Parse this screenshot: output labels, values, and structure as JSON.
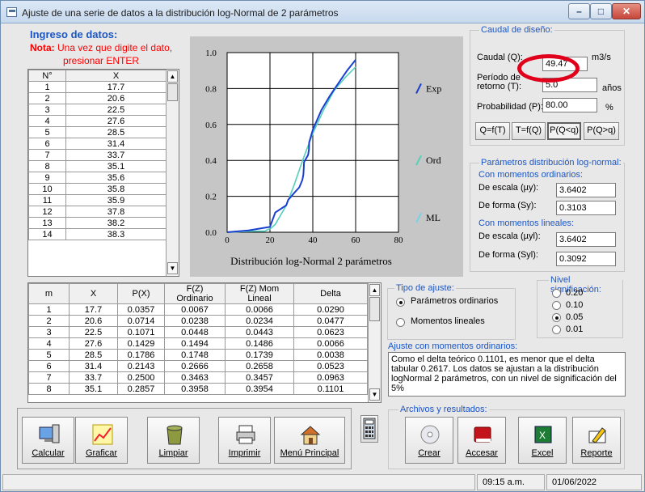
{
  "window": {
    "title": "Ajuste de una serie de datos a la distribución log-Normal de 2 parámetros"
  },
  "ingreso": {
    "title": "Ingreso de datos:",
    "note_bold": "Nota:",
    "note_text": "Una vez que digite el dato,",
    "note_text2": "presionar ENTER"
  },
  "table1": {
    "headers": [
      "N°",
      "X"
    ],
    "rows": [
      [
        "1",
        "17.7"
      ],
      [
        "2",
        "20.6"
      ],
      [
        "3",
        "22.5"
      ],
      [
        "4",
        "27.6"
      ],
      [
        "5",
        "28.5"
      ],
      [
        "6",
        "31.4"
      ],
      [
        "7",
        "33.7"
      ],
      [
        "8",
        "35.1"
      ],
      [
        "9",
        "35.6"
      ],
      [
        "10",
        "35.8"
      ],
      [
        "11",
        "35.9"
      ],
      [
        "12",
        "37.8"
      ],
      [
        "13",
        "38.2"
      ],
      [
        "14",
        "38.3"
      ]
    ]
  },
  "chart": {
    "legend": [
      "Exp",
      "Ord",
      "ML"
    ],
    "xlabel": "Distribución log-Normal 2 parámetros",
    "ylabel_ticks": [
      "0.0",
      "0.2",
      "0.4",
      "0.6",
      "0.8",
      "1.0"
    ],
    "xlabel_ticks": [
      "0",
      "20",
      "40",
      "60",
      "80"
    ]
  },
  "chart_data": {
    "type": "line",
    "title": "",
    "xlabel": "Distribución log-Normal 2 parámetros",
    "xlim": [
      0,
      80
    ],
    "ylim": [
      0,
      1
    ],
    "x_ticks": [
      0,
      20,
      40,
      60,
      80
    ],
    "y_ticks": [
      0,
      0.2,
      0.4,
      0.6,
      0.8,
      1.0
    ],
    "grid": true,
    "legend_position": "right",
    "series": [
      {
        "name": "Exp",
        "color": "#1a3fd0",
        "x": [
          0,
          10,
          20,
          22.5,
          27.6,
          28.5,
          31.4,
          33.7,
          35.1,
          35.6,
          35.8,
          35.9,
          37.8,
          38.2,
          38.3,
          40,
          44,
          48,
          52,
          56,
          60
        ],
        "y": [
          0,
          0.01,
          0.03,
          0.11,
          0.15,
          0.18,
          0.22,
          0.25,
          0.29,
          0.32,
          0.36,
          0.39,
          0.43,
          0.46,
          0.5,
          0.57,
          0.68,
          0.76,
          0.83,
          0.9,
          0.96
        ]
      },
      {
        "name": "Ord",
        "color": "#56d0b8",
        "x": [
          0,
          10,
          17.7,
          20.6,
          22.5,
          27.6,
          31.4,
          35.1,
          40,
          45,
          50,
          55,
          60
        ],
        "y": [
          0,
          0.005,
          0.007,
          0.024,
          0.045,
          0.149,
          0.267,
          0.396,
          0.55,
          0.68,
          0.79,
          0.86,
          0.92
        ]
      },
      {
        "name": "ML",
        "color": "#76d3e8",
        "x": [
          0,
          10,
          17.7,
          20.6,
          22.5,
          27.6,
          31.4,
          35.1,
          40,
          45,
          50,
          55,
          60
        ],
        "y": [
          0,
          0.005,
          0.007,
          0.023,
          0.044,
          0.149,
          0.266,
          0.395,
          0.55,
          0.68,
          0.79,
          0.86,
          0.92
        ]
      }
    ]
  },
  "table2": {
    "headers": [
      "m",
      "X",
      "P(X)",
      "F(Z) Ordinario",
      "F(Z) Mom Lineal",
      "Delta"
    ],
    "rows": [
      [
        "1",
        "17.7",
        "0.0357",
        "0.0067",
        "0.0066",
        "0.0290"
      ],
      [
        "2",
        "20.6",
        "0.0714",
        "0.0238",
        "0.0234",
        "0.0477"
      ],
      [
        "3",
        "22.5",
        "0.1071",
        "0.0448",
        "0.0443",
        "0.0623"
      ],
      [
        "4",
        "27.6",
        "0.1429",
        "0.1494",
        "0.1486",
        "0.0066"
      ],
      [
        "5",
        "28.5",
        "0.1786",
        "0.1748",
        "0.1739",
        "0.0038"
      ],
      [
        "6",
        "31.4",
        "0.2143",
        "0.2666",
        "0.2658",
        "0.0523"
      ],
      [
        "7",
        "33.7",
        "0.2500",
        "0.3463",
        "0.3457",
        "0.0963"
      ],
      [
        "8",
        "35.1",
        "0.2857",
        "0.3958",
        "0.3954",
        "0.1101"
      ]
    ]
  },
  "caudal": {
    "title": "Caudal de diseño:",
    "q_label": "Caudal (Q):",
    "q_value": "49.47",
    "q_unit": "m3/s",
    "t_label1": "Período de",
    "t_label2": "retorno (T):",
    "t_value": "5.0",
    "t_unit": "años",
    "p_label": "Probabilidad (P):",
    "p_value": "80.00",
    "p_unit": "%",
    "buttons": [
      "Q=f(T)",
      "T=f(Q)",
      "P(Q<q)",
      "P(Q>q)"
    ]
  },
  "params": {
    "title": "Parámetros distribución log-normal:",
    "ord_title": "Con momentos ordinarios:",
    "escala_label": "De escala (µy):",
    "escala_value": "3.6402",
    "forma_label": "De forma (Sy):",
    "forma_value": "0.3103",
    "lin_title": "Con momentos lineales:",
    "escala_l_label": "De escala (µyl):",
    "escala_l_value": "3.6402",
    "forma_l_label": "De forma (Syl):",
    "forma_l_value": "0.3092"
  },
  "tipo": {
    "title": "Tipo de ajuste:",
    "options": [
      "Parámetros ordinarios",
      "Momentos lineales"
    ],
    "selected": 0
  },
  "nivel": {
    "title": "Nivel significación:",
    "options": [
      "0.20",
      "0.10",
      "0.05",
      "0.01"
    ],
    "selected": 2
  },
  "ajuste": {
    "title": "Ajuste con momentos ordinarios:",
    "text": "Como el delta teórico 0.1101, es menor que el delta tabular 0.2617. Los datos se ajustan a la distribución logNormal 2 parámetros, con un nivel de significación del 5%"
  },
  "tools": [
    "Calcular",
    "Graficar",
    "Limpiar",
    "Imprimir",
    "Menú Principal"
  ],
  "archivos": {
    "title": "Archivos y resultados:",
    "buttons": [
      "Crear",
      "Accesar",
      "Excel",
      "Reporte"
    ]
  },
  "status": {
    "time": "09:15 a.m.",
    "date": "01/06/2022"
  },
  "colors": {
    "accent": "#1b56c6",
    "red_note": "#ff0000",
    "highlight": "#e0001b"
  }
}
